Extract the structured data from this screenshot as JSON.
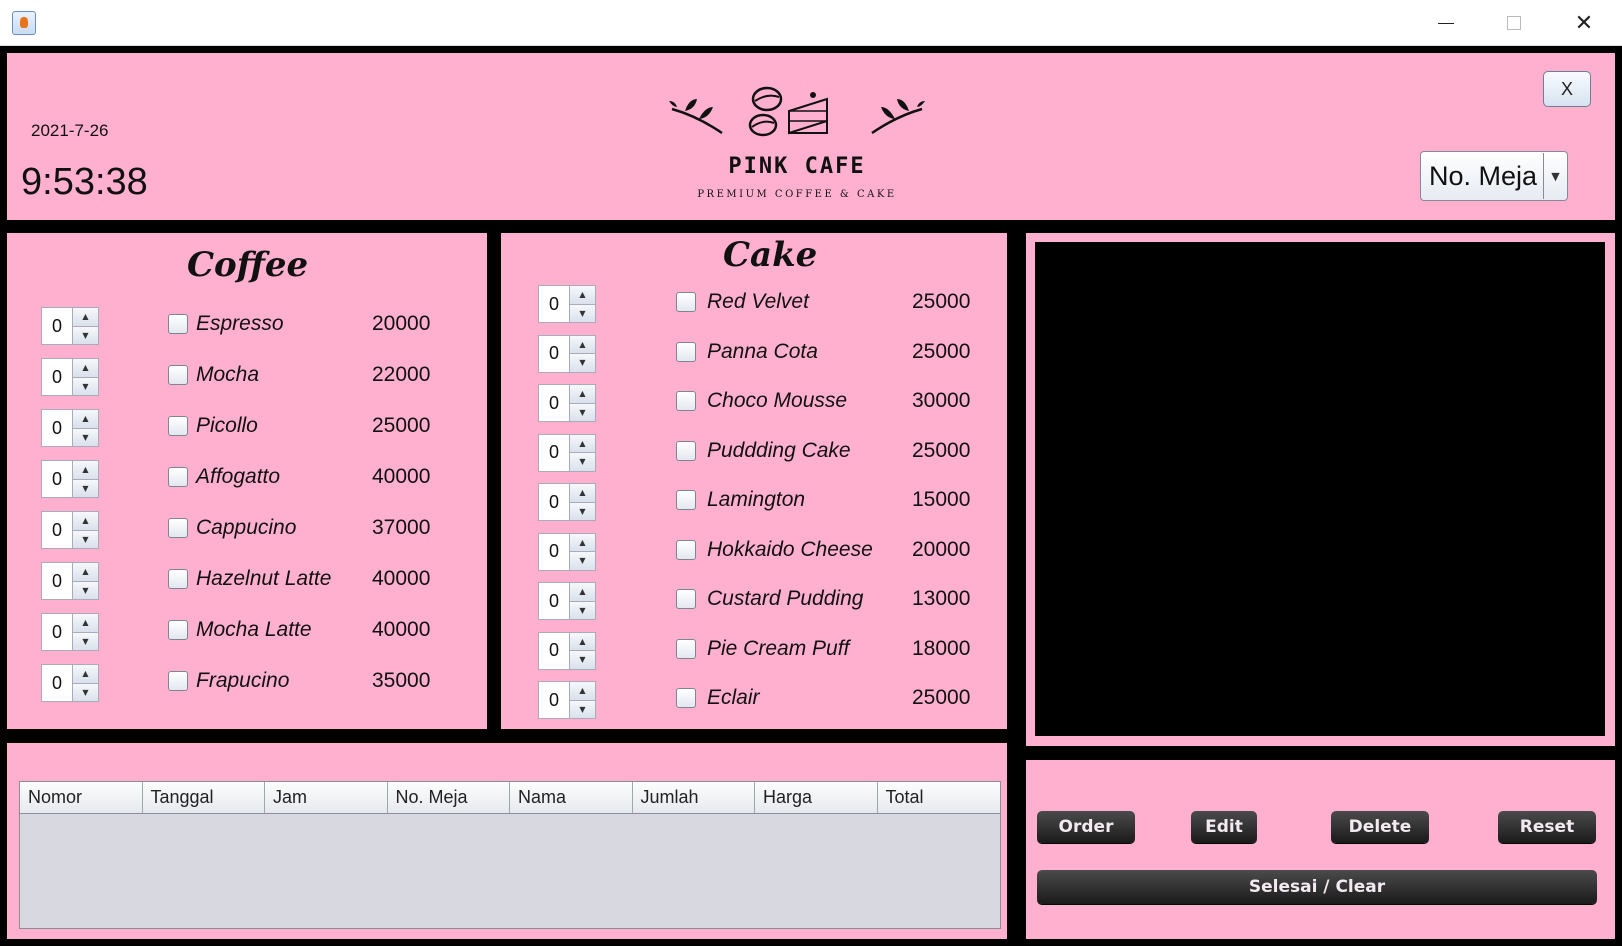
{
  "window": {
    "app_icon": "java-cup-icon",
    "controls": {
      "minimize": "—",
      "maximize": "□",
      "close": "✕"
    }
  },
  "header": {
    "date": "2021-7-26",
    "time": "9:53:38",
    "brand_name": "PINK CAFE",
    "brand_tagline": "PREMIUM COFFEE & CAKE",
    "close_button": "X",
    "table_select": {
      "selected": "No. Meja"
    }
  },
  "coffee": {
    "title": "Coffee",
    "items": [
      {
        "qty": "0",
        "name": "Espresso",
        "price": "20000"
      },
      {
        "qty": "0",
        "name": "Mocha",
        "price": "22000"
      },
      {
        "qty": "0",
        "name": "Picollo",
        "price": "25000"
      },
      {
        "qty": "0",
        "name": "Affogatto",
        "price": "40000"
      },
      {
        "qty": "0",
        "name": "Cappucino",
        "price": "37000"
      },
      {
        "qty": "0",
        "name": "Hazelnut Latte",
        "price": "40000"
      },
      {
        "qty": "0",
        "name": "Mocha Latte",
        "price": "40000"
      },
      {
        "qty": "0",
        "name": "Frapucino",
        "price": "35000"
      }
    ]
  },
  "cake": {
    "title": "Cake",
    "items": [
      {
        "qty": "0",
        "name": "Red Velvet",
        "price": "25000"
      },
      {
        "qty": "0",
        "name": "Panna Cota",
        "price": "25000"
      },
      {
        "qty": "0",
        "name": "Choco Mousse",
        "price": "30000"
      },
      {
        "qty": "0",
        "name": "Puddding Cake",
        "price": "25000"
      },
      {
        "qty": "0",
        "name": "Lamington",
        "price": "15000"
      },
      {
        "qty": "0",
        "name": "Hokkaido Cheese",
        "price": "20000"
      },
      {
        "qty": "0",
        "name": "Custard Pudding",
        "price": "13000"
      },
      {
        "qty": "0",
        "name": "Pie Cream Puff",
        "price": "18000"
      },
      {
        "qty": "0",
        "name": "Eclair",
        "price": "25000"
      }
    ]
  },
  "orders_table": {
    "columns": [
      "Nomor",
      "Tanggal",
      "Jam",
      "No. Meja",
      "Nama",
      "Jumlah",
      "Harga",
      "Total"
    ],
    "rows": []
  },
  "actions": {
    "order": "Order",
    "edit": "Edit",
    "delete": "Delete",
    "reset": "Reset",
    "finish": "Selesai / Clear"
  },
  "colors": {
    "panel_bg": "#ffb0cf",
    "frame_bg": "#000000",
    "button_bg": "#2a2a2a"
  }
}
